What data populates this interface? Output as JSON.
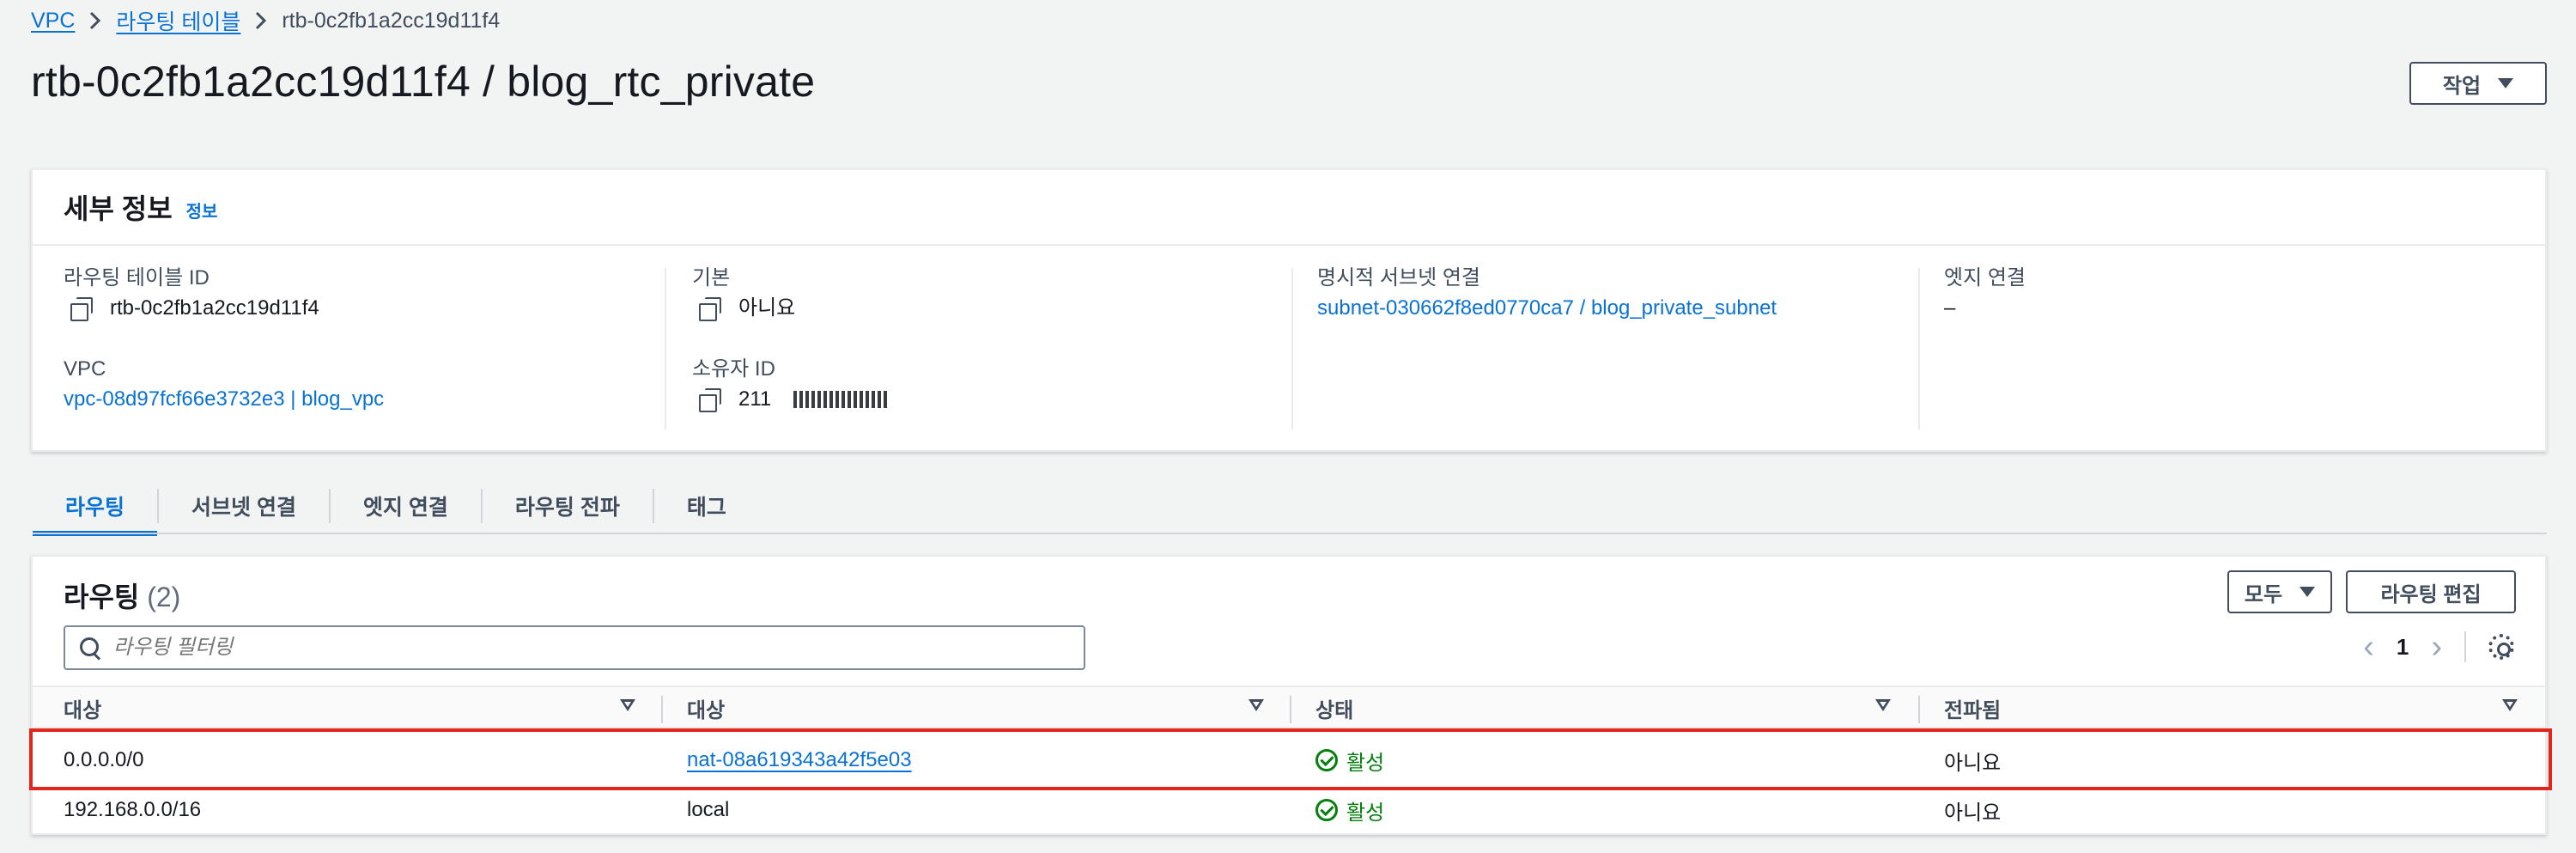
{
  "breadcrumb": {
    "items": [
      "VPC",
      "라우팅 테이블"
    ],
    "current": "rtb-0c2fb1a2cc19d11f4"
  },
  "page": {
    "title": "rtb-0c2fb1a2cc19d11f4 / blog_rtc_private",
    "actions_label": "작업"
  },
  "details": {
    "title": "세부 정보",
    "info_link": "정보",
    "route_table_id_label": "라우팅 테이블 ID",
    "route_table_id": "rtb-0c2fb1a2cc19d11f4",
    "vpc_label": "VPC",
    "vpc_value": "vpc-08d97fcf66e3732e3 | blog_vpc",
    "main_label": "기본",
    "main_value": "아니요",
    "owner_label": "소유자 ID",
    "owner_value": "211",
    "explicit_subnet_label": "명시적 서브넷 연결",
    "explicit_subnet_value": "subnet-030662f8ed0770ca7 / blog_private_subnet",
    "edge_label": "엣지 연결",
    "edge_value": "–"
  },
  "tabs": [
    {
      "label": "라우팅",
      "active": true
    },
    {
      "label": "서브넷 연결",
      "active": false
    },
    {
      "label": "엣지 연결",
      "active": false
    },
    {
      "label": "라우팅 전파",
      "active": false
    },
    {
      "label": "태그",
      "active": false
    }
  ],
  "routes": {
    "title": "라우팅",
    "count": "(2)",
    "filter_select": "모두",
    "edit_button": "라우팅 편집",
    "search_placeholder": "라우팅 필터링",
    "page": "1",
    "columns": [
      "대상",
      "대상",
      "상태",
      "전파됨"
    ],
    "rows": [
      {
        "destination": "0.0.0.0/0",
        "target": "nat-08a619343a42f5e03",
        "target_is_link": true,
        "status": "활성",
        "propagated": "아니요"
      },
      {
        "destination": "192.168.0.0/16",
        "target": "local",
        "target_is_link": false,
        "status": "활성",
        "propagated": "아니요"
      }
    ]
  }
}
